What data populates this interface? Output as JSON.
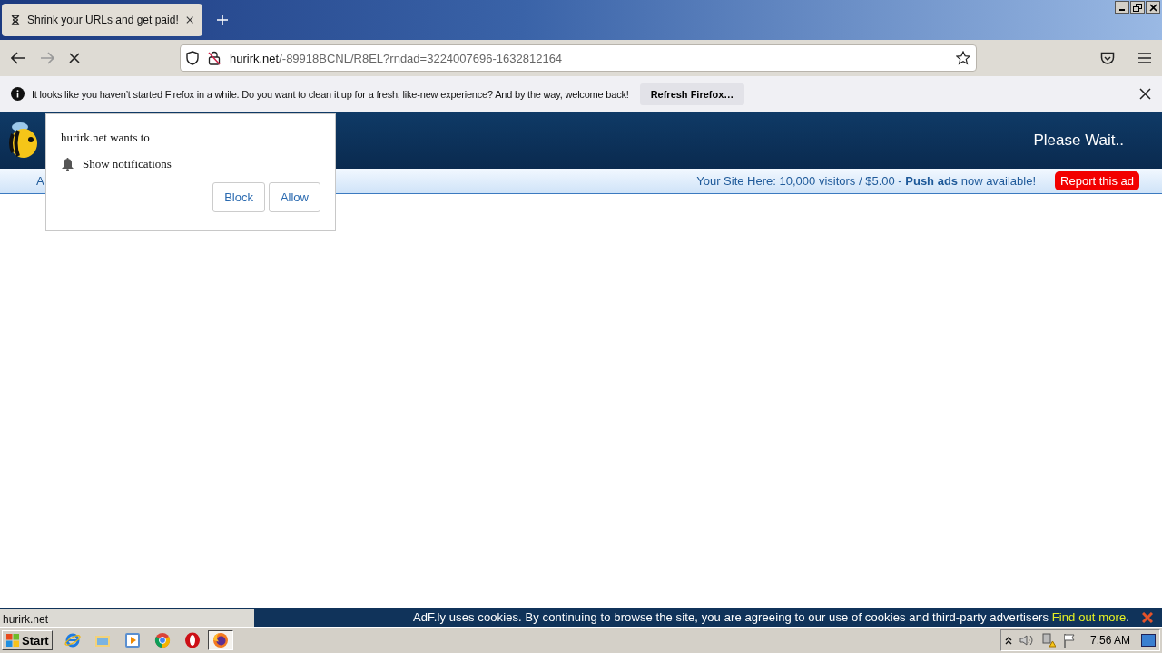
{
  "tabs": [
    {
      "title": "Shrink your URLs and get paid!",
      "selected": true
    }
  ],
  "address_bar": {
    "host": "hurirk.net",
    "path": "/-89918BCNL/R8EL?rndad=3224007696-1632812164"
  },
  "notification_bar": {
    "message": "It looks like you haven’t started Firefox in a while. Do you want to clean it up for a fresh, like-new experience? And by the way, welcome back!",
    "button": "Refresh Firefox…"
  },
  "site_header": {
    "status": "Please Wait..",
    "nav_text": "A",
    "ad_text": "Your Site Here: 10,000 visitors / $5.00 - **Push ads** now available!",
    "report_button": "Report this ad"
  },
  "permission_popup": {
    "title": "hurirk.net wants to",
    "permission": "Show notifications",
    "buttons": [
      "Block",
      "Allow"
    ]
  },
  "status_text": "hurirk.net",
  "cookie_bar": {
    "message": "AdF.ly uses cookies. By continuing to browse the site, you are agreeing to our use of cookies and third-party advertisers",
    "link": "Find out more",
    "end": "."
  },
  "taskbar": {
    "start": "Start",
    "apps": [
      {
        "kind": "ie",
        "selected": false
      },
      {
        "kind": "folder",
        "selected": false
      },
      {
        "kind": "media",
        "selected": false
      },
      {
        "kind": "chrome",
        "selected": false
      },
      {
        "kind": "opera",
        "selected": false
      },
      {
        "kind": "firefox",
        "selected": true
      }
    ],
    "clock": "7:56 AM"
  }
}
